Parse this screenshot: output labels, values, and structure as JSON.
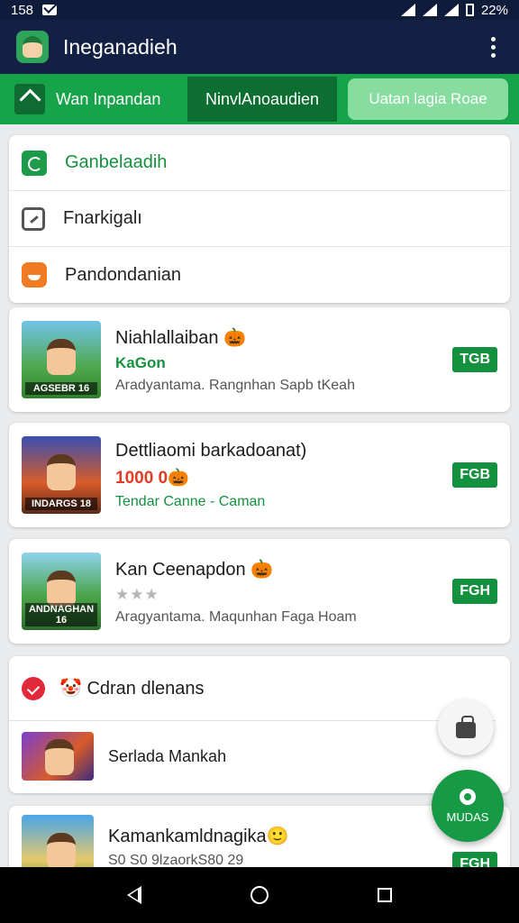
{
  "status": {
    "time": "158",
    "battery": "22%"
  },
  "appbar": {
    "title": "Ineganadieh"
  },
  "tabs": [
    {
      "label": "Wan Inpandan"
    },
    {
      "label": "NinvlAnoaudien"
    },
    {
      "label": "Uatan lagia Roae"
    }
  ],
  "menu": [
    {
      "label": "Ganbelaadih",
      "icon": "refresh-icon"
    },
    {
      "label": "Fnarkigalı",
      "icon": "edit-icon"
    },
    {
      "label": "Pandondanian",
      "icon": "emoji-icon"
    }
  ],
  "games": [
    {
      "title": "Niahlallaiban 🎃",
      "sub": "KaGon",
      "desc": "Aradyantama. Rangnhan Sapb tKeah",
      "badge": "TGB",
      "thumb_label": "AGSEBR 16"
    },
    {
      "title": "Dettliaomi barkadoanat)",
      "sub": "1000 0🎃",
      "desc": "Tendar Canne - Caman",
      "badge": "FGB",
      "thumb_label": "INDARGS 18"
    },
    {
      "title": "Kan Ceenapdon 🎃",
      "sub": "★★★",
      "desc": "Aragyantama. Maqunhan Faga Hoam",
      "badge": "FGH",
      "thumb_label": "ANDNAGHAN 16"
    }
  ],
  "list": {
    "header": "🤡 Cdran dlenans",
    "item": "Serlada Mankah"
  },
  "last_game": {
    "title": "Kamankamldnagika🙂",
    "sub": "S0 S0 9lzaorkS80 29",
    "badge": "FGH"
  },
  "fab": {
    "label": "MUDAS"
  },
  "colors": {
    "primary": "#17a34a",
    "dark": "#122043",
    "accent_red": "#e23b23"
  }
}
